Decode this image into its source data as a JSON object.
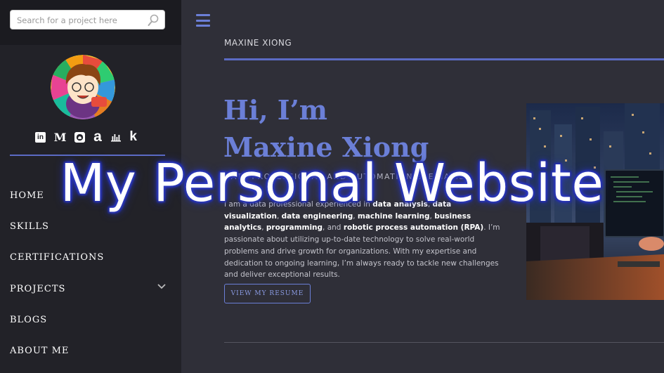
{
  "search": {
    "placeholder": "Search for a project here"
  },
  "sidebar": {
    "avatar_icon": "avatar-cartoon",
    "socials": [
      {
        "icon": "linkedin-icon",
        "glyph": "in"
      },
      {
        "icon": "medium-icon",
        "glyph": "M"
      },
      {
        "icon": "github-icon"
      },
      {
        "icon": "amazon-icon",
        "glyph": "a"
      },
      {
        "icon": "chart-icon"
      },
      {
        "icon": "kaggle-icon",
        "glyph": "k"
      }
    ],
    "nav": [
      {
        "label": "HOME"
      },
      {
        "label": "SKILLS"
      },
      {
        "label": "CERTIFICATIONS"
      },
      {
        "label": "PROJECTS",
        "has_submenu": true
      },
      {
        "label": "BLOGS"
      },
      {
        "label": "ABOUT ME"
      }
    ]
  },
  "header": {
    "site_name": "MAXINE XIONG",
    "menu_icon": "hamburger-icon"
  },
  "hero": {
    "greeting": "Hi, I’m",
    "name": "Maxine Xiong",
    "subtitle": "DATA PROFESSIONAL AND AUTOMATION SPECIALIST",
    "body_intro": "I am a data professional experienced in",
    "skill_1": "data analysis",
    "skill_2": "data visualization",
    "skill_3": "data engineering",
    "skill_4": "machine learning",
    "skill_5": "business analytics",
    "skill_6": "programming",
    "skill_7": "robotic process automation (RPA)",
    "body_rest": ". I’m passionate about utilizing up-to-date technology to solve real-world problems and drive growth for organizations. With my expertise and dedication to ongoing learning, I’m always ready to tackle new challenges and deliver exceptional results.",
    "resume_button": "VIEW MY RESUME"
  },
  "overlay": {
    "title": "My Personal Website"
  },
  "colors": {
    "accent": "#6b7fd7",
    "sidebar_bg": "#222228",
    "main_bg": "#2f2f38"
  }
}
